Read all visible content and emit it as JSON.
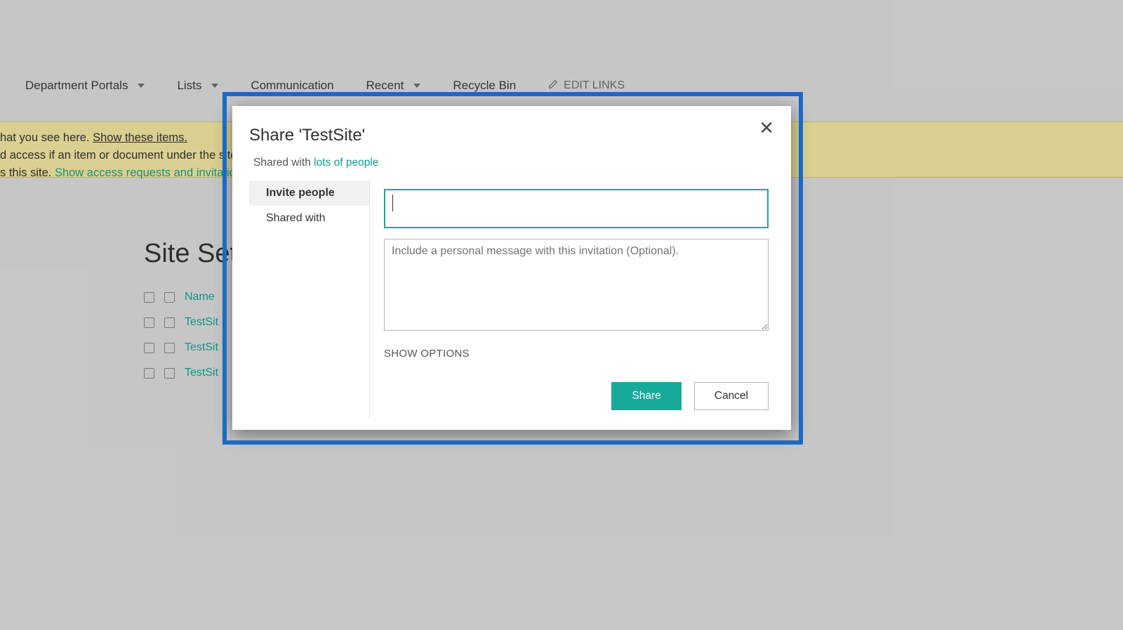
{
  "nav": {
    "items": [
      {
        "label": "Department Portals",
        "hasDropdown": true
      },
      {
        "label": "Lists",
        "hasDropdown": true
      },
      {
        "label": "Communication",
        "hasDropdown": false
      },
      {
        "label": "Recent",
        "hasDropdown": true
      },
      {
        "label": "Recycle Bin",
        "hasDropdown": false
      }
    ],
    "editLinks": "EDIT LINKS"
  },
  "notice": {
    "line1_prefix": "hat you see here.  ",
    "line1_link": "Show these items.",
    "line2": "d access if an item or document under the site",
    "line3_prefix": "s this site. ",
    "line3_link": "Show access requests and invitation"
  },
  "page": {
    "title": "Site Sett",
    "columns": {
      "name": "Name"
    },
    "rows": [
      {
        "name": "TestSit"
      },
      {
        "name": "TestSit"
      },
      {
        "name": "TestSit"
      }
    ]
  },
  "dialog": {
    "title": "Share 'TestSite'",
    "subtitle_prefix": "Shared with ",
    "subtitle_link": "lots of people",
    "tabs": [
      {
        "label": "Invite people",
        "active": true
      },
      {
        "label": "Shared with",
        "active": false
      }
    ],
    "people_input_value": "",
    "message_placeholder": "Include a personal message with this invitation (Optional).",
    "show_options_label": "SHOW OPTIONS",
    "share_button": "Share",
    "cancel_button": "Cancel",
    "close_glyph": "✕"
  }
}
